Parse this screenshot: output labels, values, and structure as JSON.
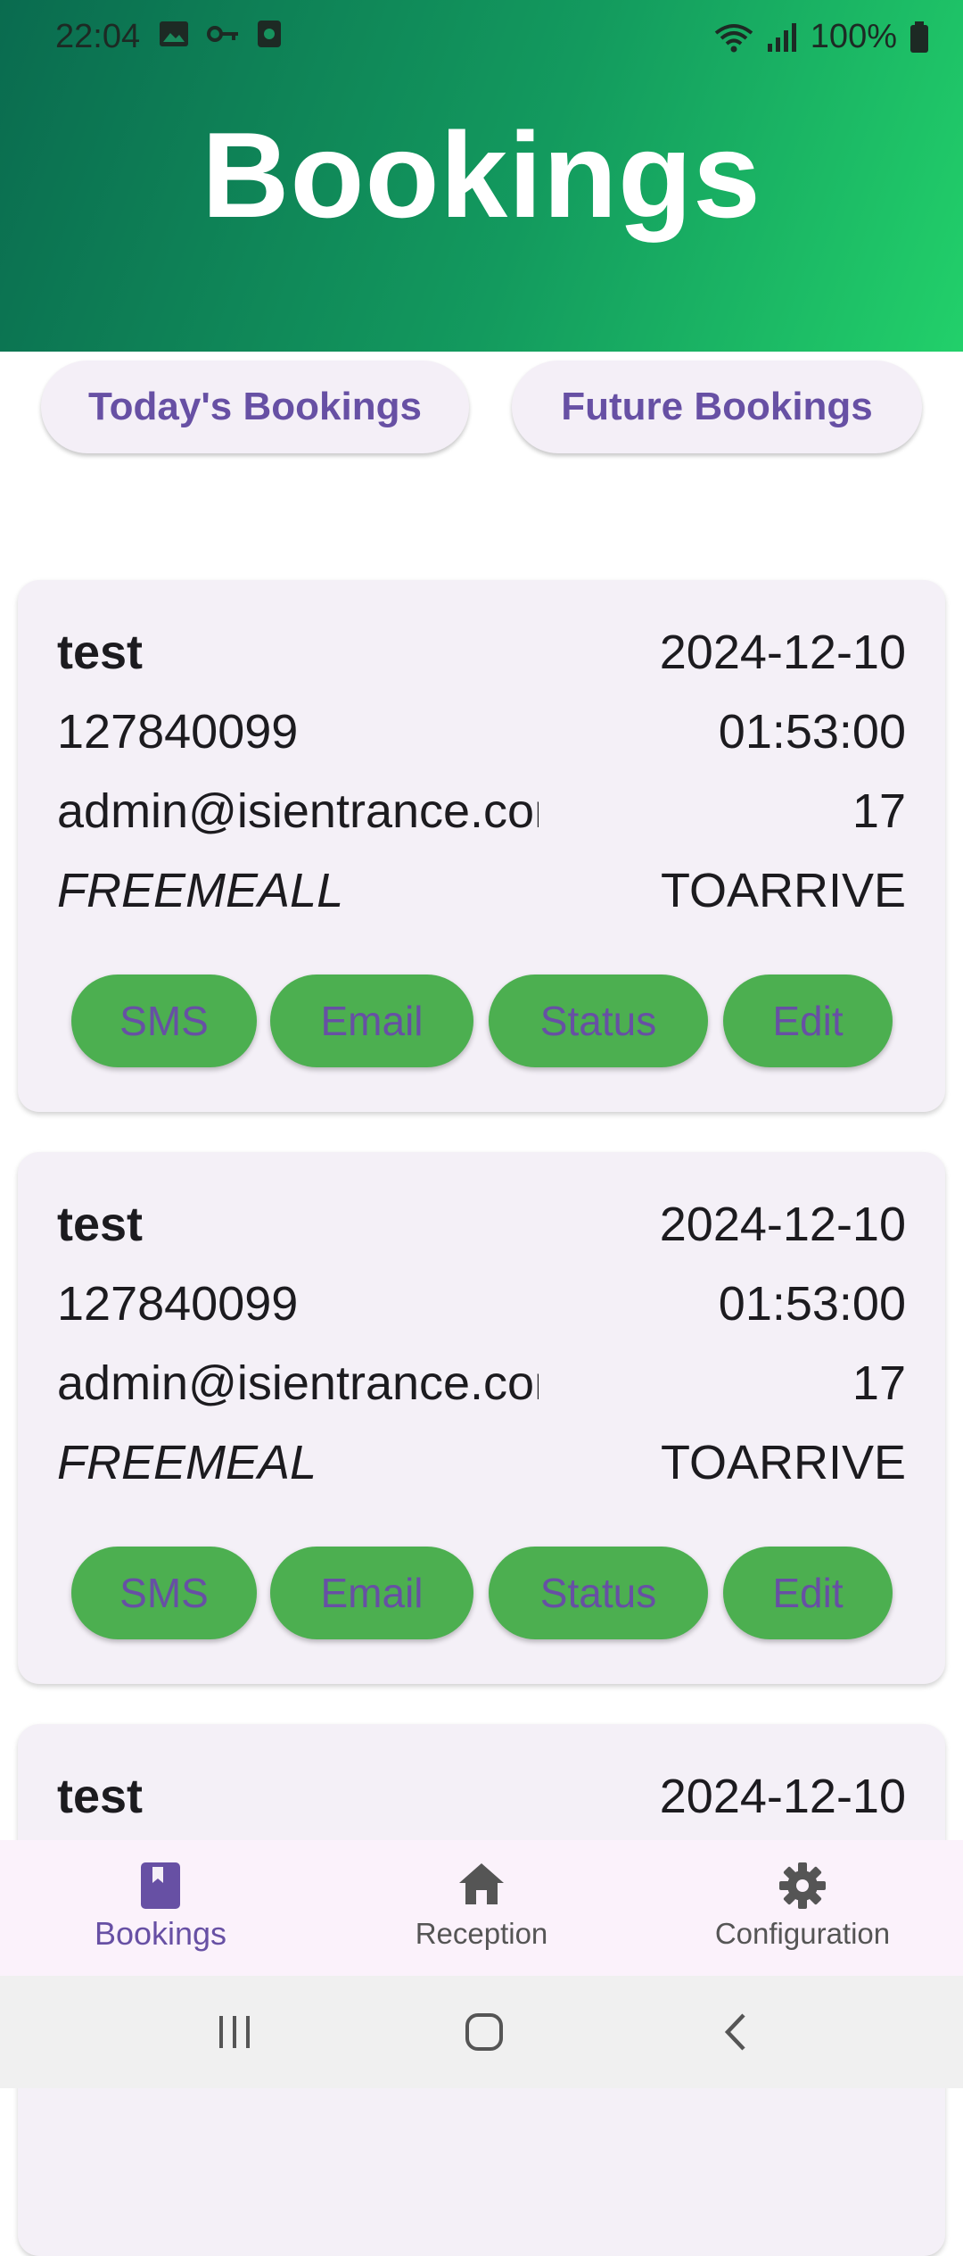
{
  "status_bar": {
    "time": "22:04",
    "battery": "100%"
  },
  "header": {
    "title": "Bookings"
  },
  "tabs": {
    "today": "Today's Bookings",
    "future": "Future Bookings"
  },
  "bookings": [
    {
      "name": "test",
      "date": "2024-12-10",
      "phone": "127840099",
      "time": "01:53:00",
      "email": "admin@isientrance.com",
      "guests": "17",
      "coupon": "FREEMEALL",
      "status": "TOARRIVE"
    },
    {
      "name": "test",
      "date": "2024-12-10",
      "phone": "127840099",
      "time": "01:53:00",
      "email": "admin@isientrance.com",
      "guests": "17",
      "coupon": "FREEMEAL",
      "status": "TOARRIVE"
    },
    {
      "name": "test",
      "date": "2024-12-10"
    }
  ],
  "actions": {
    "sms": "SMS",
    "email": "Email",
    "status": "Status",
    "edit": "Edit"
  },
  "bottom_nav": {
    "bookings": "Bookings",
    "reception": "Reception",
    "configuration": "Configuration"
  },
  "colors": {
    "accent": "#6750a4",
    "action_green": "#4caf50",
    "card_bg": "#f4f0f7"
  },
  "icons": {
    "bookings": "book-icon",
    "reception": "home-icon",
    "configuration": "gear-icon"
  }
}
